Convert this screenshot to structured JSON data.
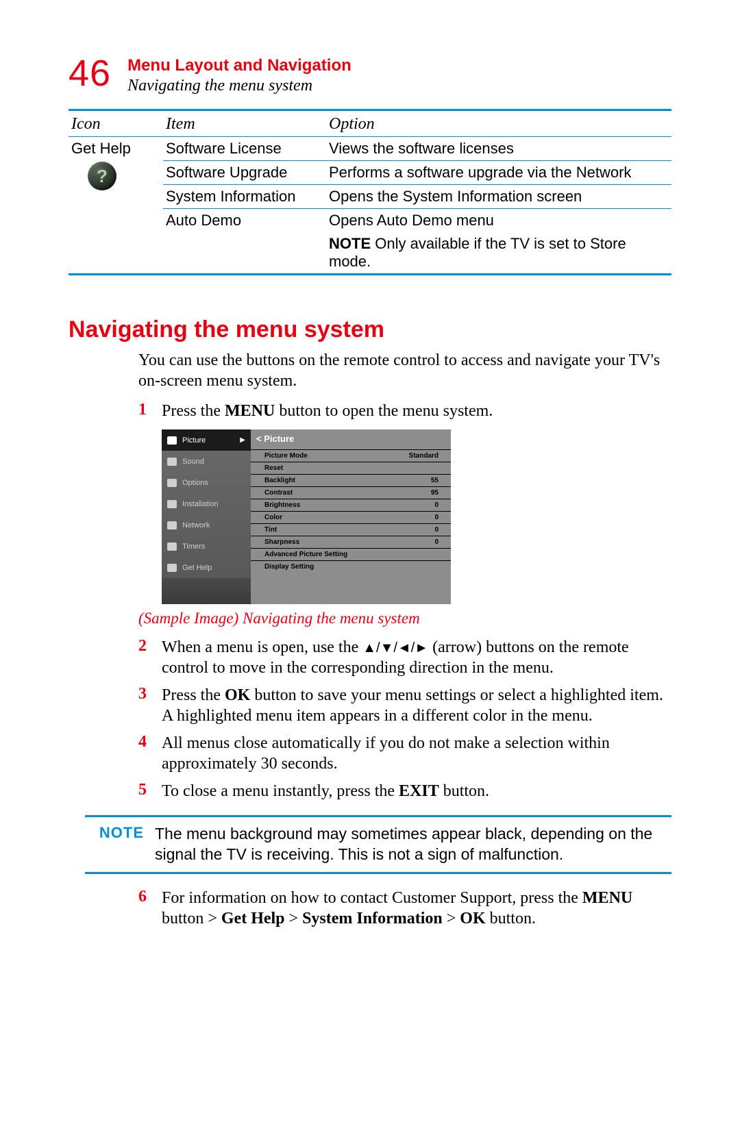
{
  "page_number": "46",
  "chapter_title": "Menu Layout and Navigation",
  "chapter_subtitle": "Navigating the menu system",
  "table": {
    "headers": {
      "icon": "Icon",
      "item": "Item",
      "option": "Option"
    },
    "icon_label": "Get Help",
    "rows": [
      {
        "item": "Software License",
        "option": "Views the software licenses"
      },
      {
        "item": "Software Upgrade",
        "option": "Performs a software upgrade via the Network"
      },
      {
        "item": "System Information",
        "option": "Opens the System Information screen"
      },
      {
        "item": "Auto Demo",
        "option": "Opens Auto Demo menu"
      }
    ],
    "footnote_bold": "NOTE",
    "footnote": "  Only available if  the TV is set to Store mode."
  },
  "section_heading": "Navigating the menu system",
  "intro": "You can use the buttons on the remote control to access and navigate your TV's on-screen menu system.",
  "steps": {
    "s1a": "Press the ",
    "s1b": "MENU",
    "s1c": " button to open the menu system.",
    "s2a": "When a menu is open, use the ",
    "s2_arrows": "▲/▼/◄/►",
    "s2b": " (arrow) buttons on the remote control to move in the corresponding direction in the menu.",
    "s3a": "Press the ",
    "s3b": "OK",
    "s3c": " button to save your menu settings or select a highlighted item.",
    "s3d": "A highlighted menu item appears in a different color in the menu.",
    "s4": "All menus close automatically if you do not make a selection within approximately 30 seconds.",
    "s5a": "To close a menu instantly, press the ",
    "s5b": "EXIT",
    "s5c": " button.",
    "s6a": "For information on how to contact Customer Support, press the ",
    "s6b": "MENU",
    "s6c": " button > ",
    "s6d": "Get Help",
    "s6e": " > ",
    "s6f": "System Information",
    "s6g": " > ",
    "s6h": "OK",
    "s6i": " button."
  },
  "caption": "(Sample Image) Navigating the menu system",
  "note_label": "NOTE",
  "note_body": "The menu background may sometimes appear black, depending on the signal the TV is receiving. This is not a sign of malfunction.",
  "screenshot": {
    "left_items": [
      "Picture",
      "Sound",
      "Options",
      "Installation",
      "Network",
      "Timers",
      "Get Help"
    ],
    "panel_title": "< Picture",
    "lines": [
      {
        "l": "Picture Mode",
        "v": "Standard"
      },
      {
        "l": "Reset",
        "v": ""
      },
      {
        "l": "Backlight",
        "v": "55"
      },
      {
        "l": "Contrast",
        "v": "95"
      },
      {
        "l": "Brightness",
        "v": "0"
      },
      {
        "l": "Color",
        "v": "0"
      },
      {
        "l": "Tint",
        "v": "0"
      },
      {
        "l": "Sharpness",
        "v": "0"
      },
      {
        "l": "Advanced Picture Setting",
        "v": ""
      },
      {
        "l": "Display Setting",
        "v": ""
      }
    ]
  }
}
